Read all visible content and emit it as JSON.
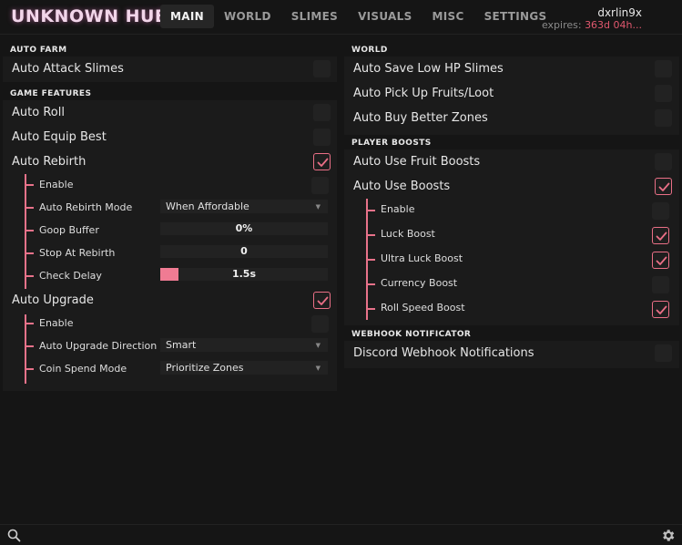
{
  "header": {
    "title": "UNKNOWN HUB",
    "tabs": [
      {
        "label": "MAIN",
        "active": true
      },
      {
        "label": "WORLD"
      },
      {
        "label": "SLIMES"
      },
      {
        "label": "VISUALS"
      },
      {
        "label": "MISC"
      },
      {
        "label": "SETTINGS"
      }
    ],
    "username": "dxrlin9x",
    "expires_label": "expires:",
    "expires_value": "363d 04h..."
  },
  "left": {
    "auto_farm": {
      "title": "AUTO FARM",
      "auto_attack": {
        "label": "Auto Attack Slimes",
        "checked": false
      }
    },
    "game_features": {
      "title": "GAME FEATURES",
      "auto_roll": {
        "label": "Auto Roll",
        "checked": false
      },
      "auto_equip": {
        "label": "Auto Equip Best",
        "checked": false
      },
      "auto_rebirth": {
        "label": "Auto Rebirth",
        "checked": true,
        "enable": {
          "label": "Enable",
          "checked": false
        },
        "mode": {
          "label": "Auto Rebirth Mode",
          "value": "When Affordable"
        },
        "goop": {
          "label": "Goop Buffer",
          "value": "0%",
          "fill": 0
        },
        "stop": {
          "label": "Stop At Rebirth",
          "value": "0",
          "fill": 0
        },
        "delay": {
          "label": "Check Delay",
          "value": "1.5s",
          "fill": 0.11
        }
      },
      "auto_upgrade": {
        "label": "Auto Upgrade",
        "checked": true,
        "enable": {
          "label": "Enable",
          "checked": false
        },
        "direction": {
          "label": "Auto Upgrade Direction",
          "value": "Smart"
        },
        "coin": {
          "label": "Coin Spend Mode",
          "value": "Prioritize Zones"
        }
      }
    }
  },
  "right": {
    "world": {
      "title": "WORLD",
      "save_low": {
        "label": "Auto Save Low HP Slimes",
        "checked": false
      },
      "pickup": {
        "label": "Auto Pick Up Fruits/Loot",
        "checked": false
      },
      "buy_zones": {
        "label": "Auto Buy Better Zones",
        "checked": false
      }
    },
    "player_boosts": {
      "title": "PLAYER BOOSTS",
      "fruit": {
        "label": "Auto Use Fruit Boosts",
        "checked": false
      },
      "boosts": {
        "label": "Auto Use Boosts",
        "checked": true,
        "enable": {
          "label": "Enable",
          "checked": false
        },
        "luck": {
          "label": "Luck Boost",
          "checked": true
        },
        "ultra": {
          "label": "Ultra Luck Boost",
          "checked": true
        },
        "currency": {
          "label": "Currency Boost",
          "checked": false
        },
        "roll_speed": {
          "label": "Roll Speed Boost",
          "checked": true
        }
      }
    },
    "webhook": {
      "title": "WEBHOOK NOTIFICATOR",
      "discord": {
        "label": "Discord Webhook Notifications",
        "checked": false
      }
    }
  },
  "colors": {
    "accent": "#ea6f86",
    "background": "#151515",
    "panel": "#1b1b1b",
    "control": "#222222"
  },
  "footer": {
    "search_placeholder": ""
  }
}
